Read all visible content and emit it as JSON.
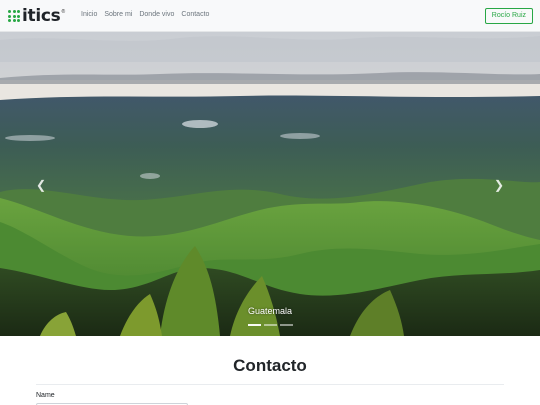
{
  "brand": {
    "name": "itics",
    "trademark": "®",
    "accent": "#28a745"
  },
  "nav": {
    "items": [
      {
        "label": "Inicio"
      },
      {
        "label": "Sobre mi"
      },
      {
        "label": "Donde vivo"
      },
      {
        "label": "Contacto"
      }
    ],
    "user_button": "Rocío Ruiz"
  },
  "carousel": {
    "caption": "Guatemala",
    "prev_icon": "chevron-left-icon",
    "next_icon": "chevron-right-icon",
    "slide_count": 3,
    "active_slide": 1
  },
  "contact": {
    "title": "Contacto",
    "name_label": "Name"
  }
}
